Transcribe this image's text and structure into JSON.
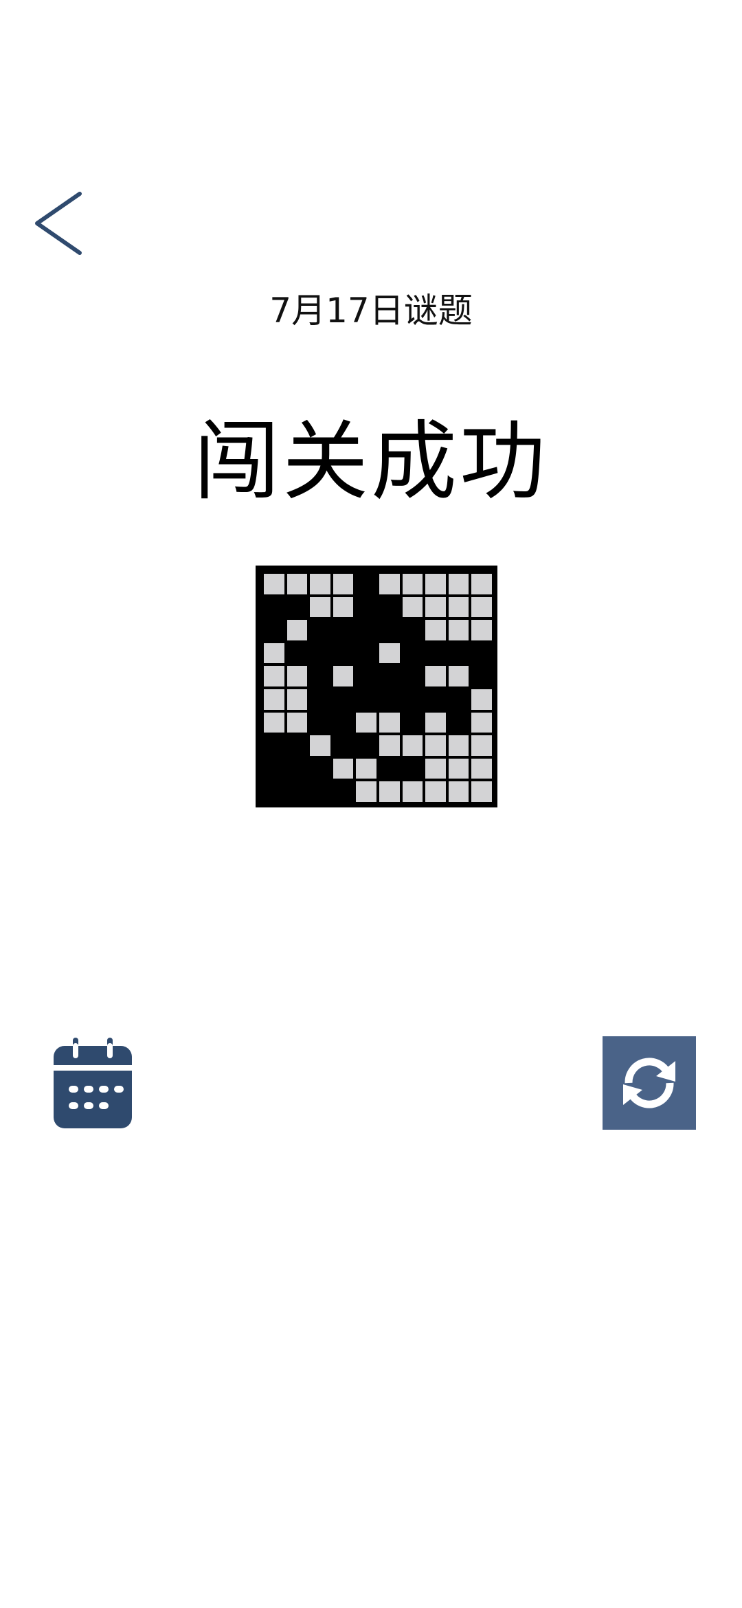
{
  "header": {
    "back_icon": "chevron-left-icon"
  },
  "puzzle": {
    "date_label": "7月17日谜题",
    "result_title": "闯关成功",
    "size": 10,
    "grid": [
      "0000100000",
      "1100110000",
      "1011111000",
      "0111101111",
      "0010111001",
      "0011111110",
      "0011001010",
      "1101100000",
      "1110011000",
      "1111000000"
    ]
  },
  "actions": {
    "calendar_icon": "calendar-icon",
    "refresh_icon": "refresh-icon"
  },
  "colors": {
    "accent": "#2f4a6e",
    "refresh_bg": "#4a6388",
    "cell_empty": "#d3d3d5",
    "cell_filled": "#000000"
  }
}
